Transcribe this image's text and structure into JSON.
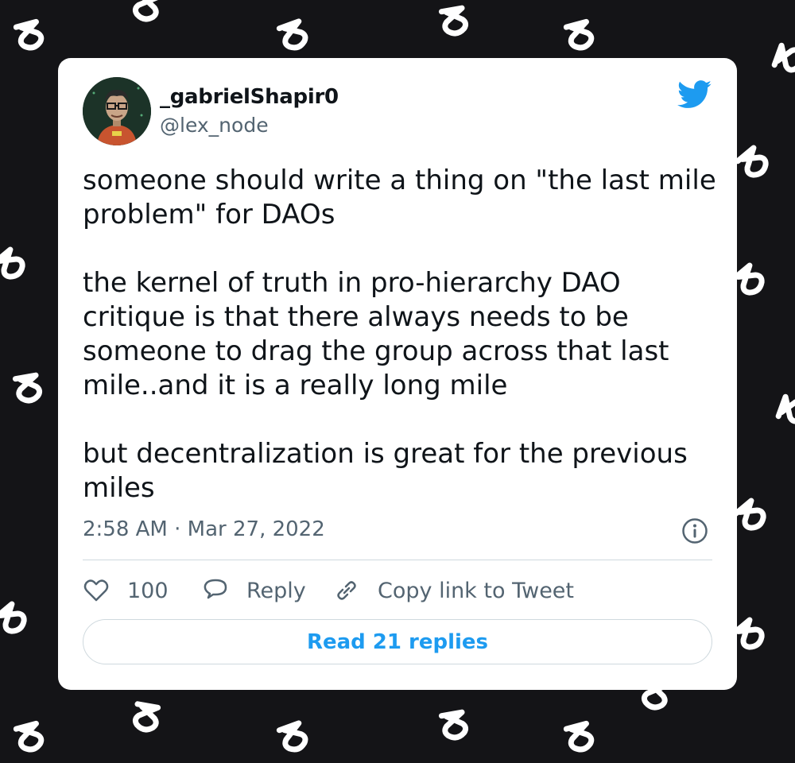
{
  "tweet": {
    "author": {
      "display_name": "_gabrielShapir0",
      "handle": "@lex_node"
    },
    "text": "someone should write a thing on \"the last mile problem\" for DAOs\n\nthe kernel of truth in pro-hierarchy DAO critique is that there always needs to be someone to drag the group across that last mile..and it is a really long mile\n\nbut decentralization is great for the previous miles",
    "timestamp": "2:58 AM · Mar 27, 2022",
    "like_count": "100",
    "reply_label": "Reply",
    "copy_link_label": "Copy link to Tweet",
    "read_replies_label": "Read 21 replies"
  },
  "colors": {
    "background": "#141417",
    "card": "#ffffff",
    "text_primary": "#0f1419",
    "text_secondary": "#536471",
    "accent": "#1d9bf0",
    "border": "#cfd9de"
  },
  "icons": {
    "brand": "twitter-bird-icon",
    "info": "info-icon",
    "like": "heart-icon",
    "reply": "speech-bubble-icon",
    "copy_link": "link-icon",
    "background_pattern": "glyph-pattern-icon"
  }
}
